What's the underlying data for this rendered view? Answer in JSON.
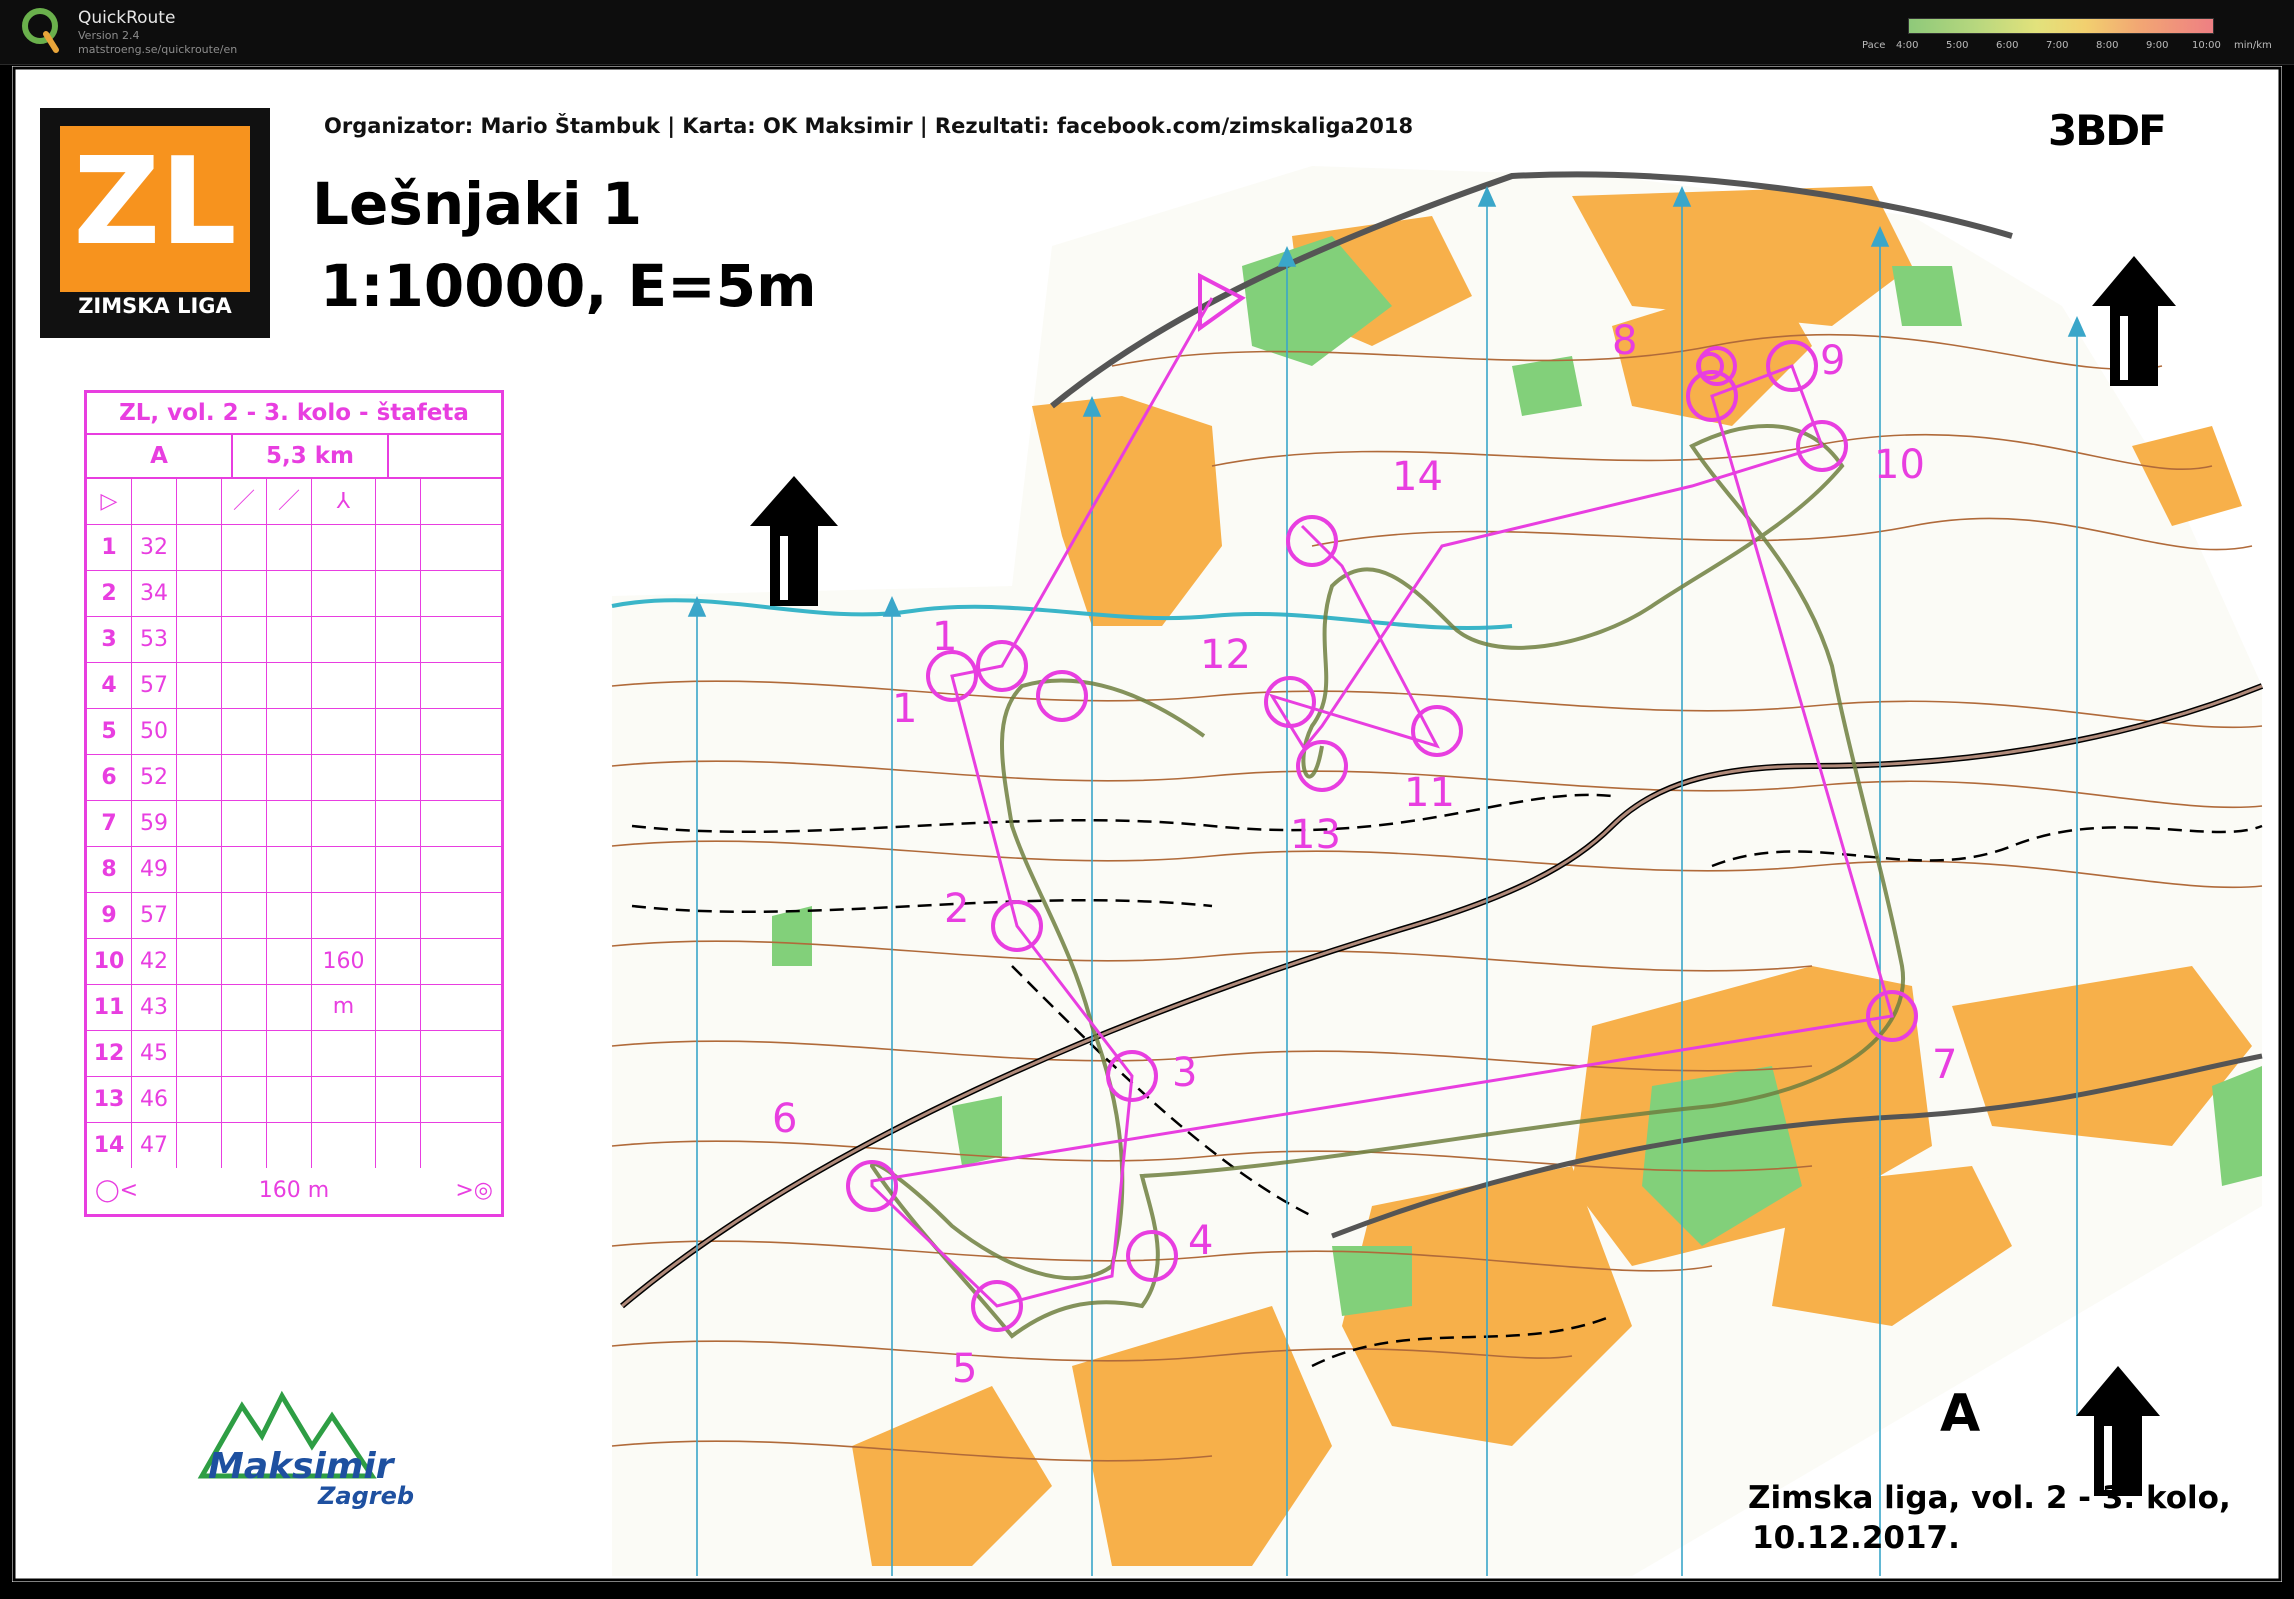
{
  "app": {
    "name": "QuickRoute",
    "version": "Version 2.4",
    "url": "matstroeng.se/quickroute/en"
  },
  "pace_legend": {
    "label": "Pace",
    "ticks": [
      "4:00",
      "5:00",
      "6:00",
      "7:00",
      "8:00",
      "9:00",
      "10:00"
    ],
    "unit": "min/km",
    "gradient_colors": [
      "#8ec97a",
      "#e2e27c",
      "#f2a873",
      "#ee7f83"
    ]
  },
  "map": {
    "organizer_line": "Organizator: Mario Štambuk | Karta: OK Maksimir | Rezultati: facebook.com/zimskaliga2018",
    "title": "Lešnjaki 1",
    "scale": "1:10000, E=5m",
    "relay_code": "3BDF",
    "logo_text": "ZL",
    "logo_subtitle": "ZIMSKA LIGA",
    "course_letter": "A",
    "event_name": "Zimska liga, vol. 2 - 3. kolo,",
    "event_date": "10.12.2017.",
    "club_logo_text": "Maksimir",
    "club_logo_sub": "Zagreb",
    "course_color": "#e83ee0",
    "colors": {
      "open_land": "#f7b04a",
      "vegetation": "#82d07a",
      "water": "#3ab5c8",
      "contour": "#b06a3a",
      "north_lines": "#3aa6c9"
    }
  },
  "description_sheet": {
    "title": "ZL, vol. 2 - 3. kolo - štafeta",
    "course": "A",
    "length": "5,3 km",
    "rows": [
      {
        "num": "1",
        "code": "32"
      },
      {
        "num": "2",
        "code": "34"
      },
      {
        "num": "3",
        "code": "53"
      },
      {
        "num": "4",
        "code": "57"
      },
      {
        "num": "5",
        "code": "50"
      },
      {
        "num": "6",
        "code": "52"
      },
      {
        "num": "7",
        "code": "59"
      },
      {
        "num": "8",
        "code": "49"
      },
      {
        "num": "9",
        "code": "57"
      },
      {
        "num": "10",
        "code": "42",
        "note": "160 m"
      },
      {
        "num": "11",
        "code": "43"
      },
      {
        "num": "12",
        "code": "45"
      },
      {
        "num": "13",
        "code": "46"
      },
      {
        "num": "14",
        "code": "47"
      }
    ],
    "finish_distance": "160 m"
  },
  "controls": {
    "labels": [
      "1",
      "2",
      "3",
      "4",
      "5",
      "6",
      "7",
      "8",
      "9",
      "10",
      "11",
      "12",
      "13",
      "14",
      "1"
    ]
  }
}
